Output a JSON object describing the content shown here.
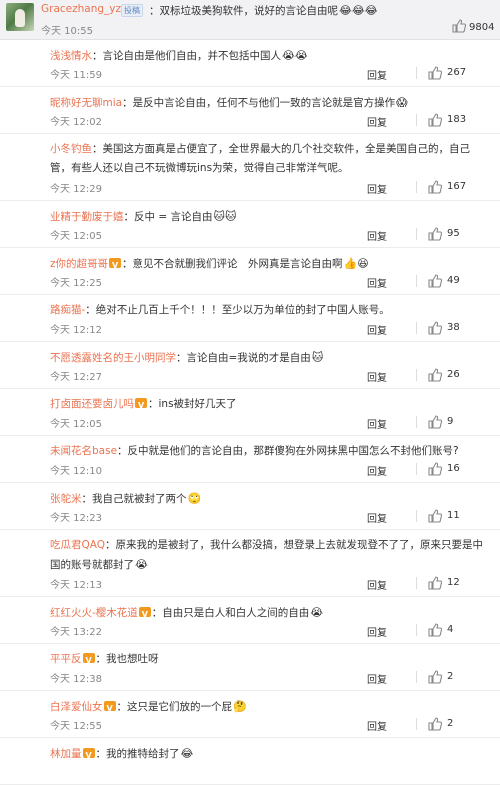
{
  "post": {
    "username": "Gracezhang_yzg",
    "badge": "投稿",
    "text": "：双标垃圾美狗软件，说好的言论自由呢",
    "emoji": "😂😂😂",
    "time": "今天 10:55",
    "likes": "9804"
  },
  "replies": [
    {
      "user": "浅浅情水",
      "vip": false,
      "text": "：言论自由是他们自由，并不包括中国人",
      "emoji": "😭😭",
      "line2": "",
      "time": "今天 11:59",
      "reply_label": "回复",
      "likes": "267"
    },
    {
      "user": "昵称好无聊mia",
      "vip": false,
      "text": "：是反中言论自由，任何不与他们一致的言论就是官方操作",
      "emoji": "😱",
      "line2": "",
      "time": "今天 12:02",
      "reply_label": "回复",
      "likes": "183"
    },
    {
      "user": "小冬钓鱼",
      "vip": false,
      "text": "：美国这方面真是占便宜了，全世界最大的几个社交软件，全是美国自己的，自己",
      "emoji": "",
      "line2": "管，有些人还以自己不玩微博玩ins为荣，觉得自己非常洋气呢。",
      "time": "今天 12:29",
      "reply_label": "回复",
      "likes": "167"
    },
    {
      "user": "业精于勤废于嬉",
      "vip": false,
      "text": "：反中 = 言论自由",
      "emoji": "🐱🐱",
      "line2": "",
      "time": "今天 12:05",
      "reply_label": "回复",
      "likes": "95"
    },
    {
      "user": "z你的超哥哥",
      "vip": true,
      "text": "：意见不合就删我们评论　外网真是言论自由啊",
      "emoji": "👍😆",
      "line2": "",
      "time": "今天 12:25",
      "reply_label": "回复",
      "likes": "49"
    },
    {
      "user": "路痴猫-",
      "vip": false,
      "text": "：绝对不止几百上千个！！！至少以万为单位的封了中国人账号。",
      "emoji": "",
      "line2": "",
      "time": "今天 12:12",
      "reply_label": "回复",
      "likes": "38"
    },
    {
      "user": "不愿透露姓名的王小明同学",
      "vip": false,
      "text": "：言论自由=我说的才是自由",
      "emoji": "🐱",
      "line2": "",
      "time": "今天 12:27",
      "reply_label": "回复",
      "likes": "26"
    },
    {
      "user": "打卤面还要卤儿吗",
      "vip": true,
      "text": "：ins被封好几天了",
      "emoji": "",
      "line2": "",
      "time": "今天 12:05",
      "reply_label": "回复",
      "likes": "9"
    },
    {
      "user": "未闻花名base",
      "vip": false,
      "text": "：反中就是他们的言论自由，那群傻狗在外网抹黑中国怎么不封他们账号?",
      "emoji": "",
      "line2": "",
      "time": "今天 12:10",
      "reply_label": "回复",
      "likes": "16"
    },
    {
      "user": "张鸵米",
      "vip": false,
      "text": "：我自己就被封了两个",
      "emoji": "🙄",
      "line2": "",
      "time": "今天 12:23",
      "reply_label": "回复",
      "likes": "11"
    },
    {
      "user": "吃瓜君QAQ",
      "vip": false,
      "text": "：原来我的是被封了，我什么都没搞，想登录上去就发现登不了了，原来只要是中",
      "emoji": "",
      "line2": "国的账号就都封了",
      "line2_emoji": "😭",
      "time": "今天 12:13",
      "reply_label": "回复",
      "likes": "12"
    },
    {
      "user": "红红火火-樱木花道",
      "vip": true,
      "text": "：自由只是白人和白人之间的自由",
      "emoji": "😭",
      "line2": "",
      "time": "今天 13:22",
      "reply_label": "回复",
      "likes": "4"
    },
    {
      "user": "平平反",
      "vip": true,
      "text": "：我也想吐呀",
      "emoji": "",
      "line2": "",
      "time": "今天 12:38",
      "reply_label": "回复",
      "likes": "2"
    },
    {
      "user": "白泽爱仙女",
      "vip": true,
      "text": "：这只是它们放的一个屁",
      "emoji": "🤔",
      "line2": "",
      "time": "今天 12:55",
      "reply_label": "回复",
      "likes": "2"
    },
    {
      "user": "林加量",
      "vip": true,
      "text": "：我的推特给封了",
      "emoji": "😂",
      "line2": "",
      "time": "",
      "reply_label": "",
      "likes": ""
    }
  ],
  "icons": {
    "like": "thumbs-up-icon",
    "vip": "vip-badge-icon"
  },
  "colors": {
    "username": "#eb7350",
    "text": "#333333",
    "meta": "#888888",
    "top_bg": "#f2f2f5"
  }
}
